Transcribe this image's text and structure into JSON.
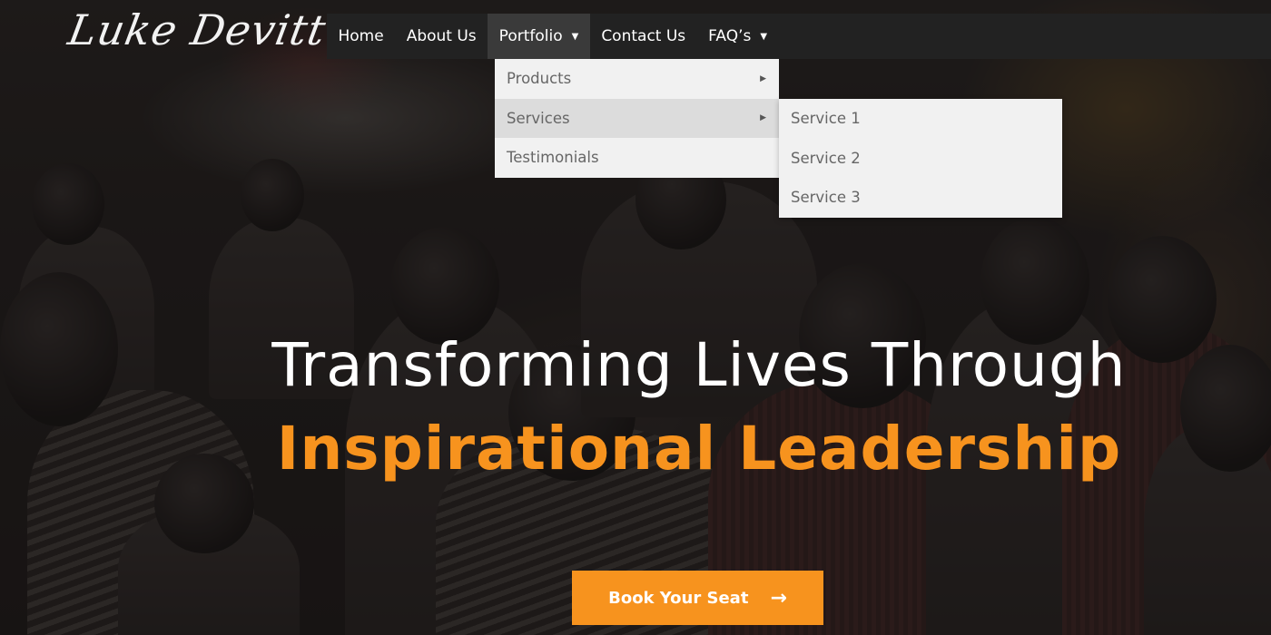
{
  "logo": {
    "text": "Luke Devitt"
  },
  "nav": {
    "home": "Home",
    "about": "About Us",
    "portfolio": "Portfolio",
    "contact": "Contact Us",
    "faq": "FAQ’s",
    "caret_icon": "triangle-down"
  },
  "portfolio_menu": {
    "items": [
      {
        "label": "Products",
        "has_submenu": true
      },
      {
        "label": "Services",
        "has_submenu": true,
        "highlighted": true
      },
      {
        "label": "Testimonials",
        "has_submenu": false
      }
    ]
  },
  "services_menu": {
    "items": [
      {
        "label": "Service 1"
      },
      {
        "label": "Service 2"
      },
      {
        "label": "Service 3"
      }
    ]
  },
  "hero": {
    "line1": "Transforming Lives Through",
    "line2": "Inspirational Leadership",
    "cta_label": "Book Your Seat",
    "cta_icon": "arrow-right-icon"
  },
  "colors": {
    "accent": "#f7931e",
    "navbar": "#222222",
    "dropdown_bg": "#f1f1f1",
    "dropdown_text": "#666666"
  }
}
